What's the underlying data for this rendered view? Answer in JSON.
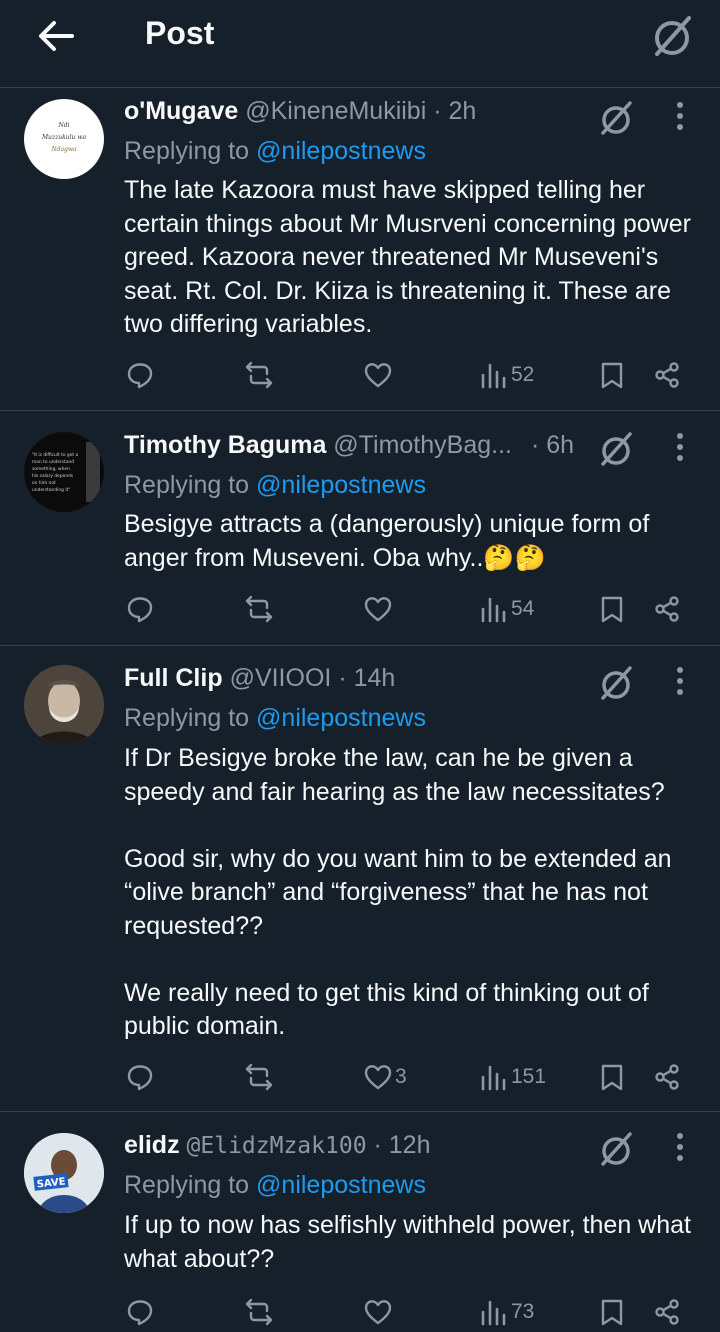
{
  "header": {
    "title": "Post"
  },
  "replying_prefix": "Replying to",
  "tweets": [
    {
      "name": "o'Mugave",
      "handle": "@KineneMukiibi",
      "time": "· 2h",
      "replying_to": "@nilepostnews",
      "text": "The late Kazoora must have skipped telling her certain things about Mr Musrveni concerning power greed. Kazoora never threatened Mr Museveni's seat. Rt. Col. Dr. Kiiza is threatening it. These are two differing variables.",
      "avatar_text": [
        "Ndi",
        "Muzzukulu wa",
        "Ndagwa"
      ],
      "likes": "",
      "views": "52"
    },
    {
      "name": "Timothy Baguma",
      "handle": "@TimothyBag...",
      "time": "· 6h",
      "replying_to": "@nilepostnews",
      "text": "Besigye attracts a (dangerously) unique form of anger from Museveni. Oba why..🤔🤔",
      "avatar_text": [
        "\"It is difficult to get a",
        "man to understand",
        "something, when",
        "his salary depends",
        "on him not",
        "understanding it\""
      ],
      "likes": "",
      "views": "54"
    },
    {
      "name": "Full Clip",
      "handle": "@VIIOOI",
      "time": "· 14h",
      "replying_to": "@nilepostnews",
      "text": "If Dr Besigye broke the law, can he be given a speedy and fair hearing as the law necessitates?\n\nGood sir, why do you want him to be extended an “olive branch” and “forgiveness” that he has not requested??\n\nWe really need to get this kind of thinking out of public domain.",
      "likes": "3",
      "views": "151"
    },
    {
      "name": "elidz",
      "handle": "@ElidzMzak100",
      "time": "· 12h",
      "replying_to": "@nilepostnews",
      "text": "If up to now has selfishly withheld power, then what what about??",
      "avatar_text": [
        "SAVE"
      ],
      "likes": "",
      "views": "73"
    }
  ],
  "colors": {
    "background": "#15202b",
    "text": "#f7f9f9",
    "muted": "#8b98a5",
    "accent": "#1d9bf0",
    "divider": "#38444d"
  },
  "icons": [
    "back-arrow-icon",
    "grok-icon",
    "more-icon",
    "reply-icon",
    "repost-icon",
    "like-icon",
    "views-icon",
    "bookmark-icon",
    "share-icon"
  ]
}
